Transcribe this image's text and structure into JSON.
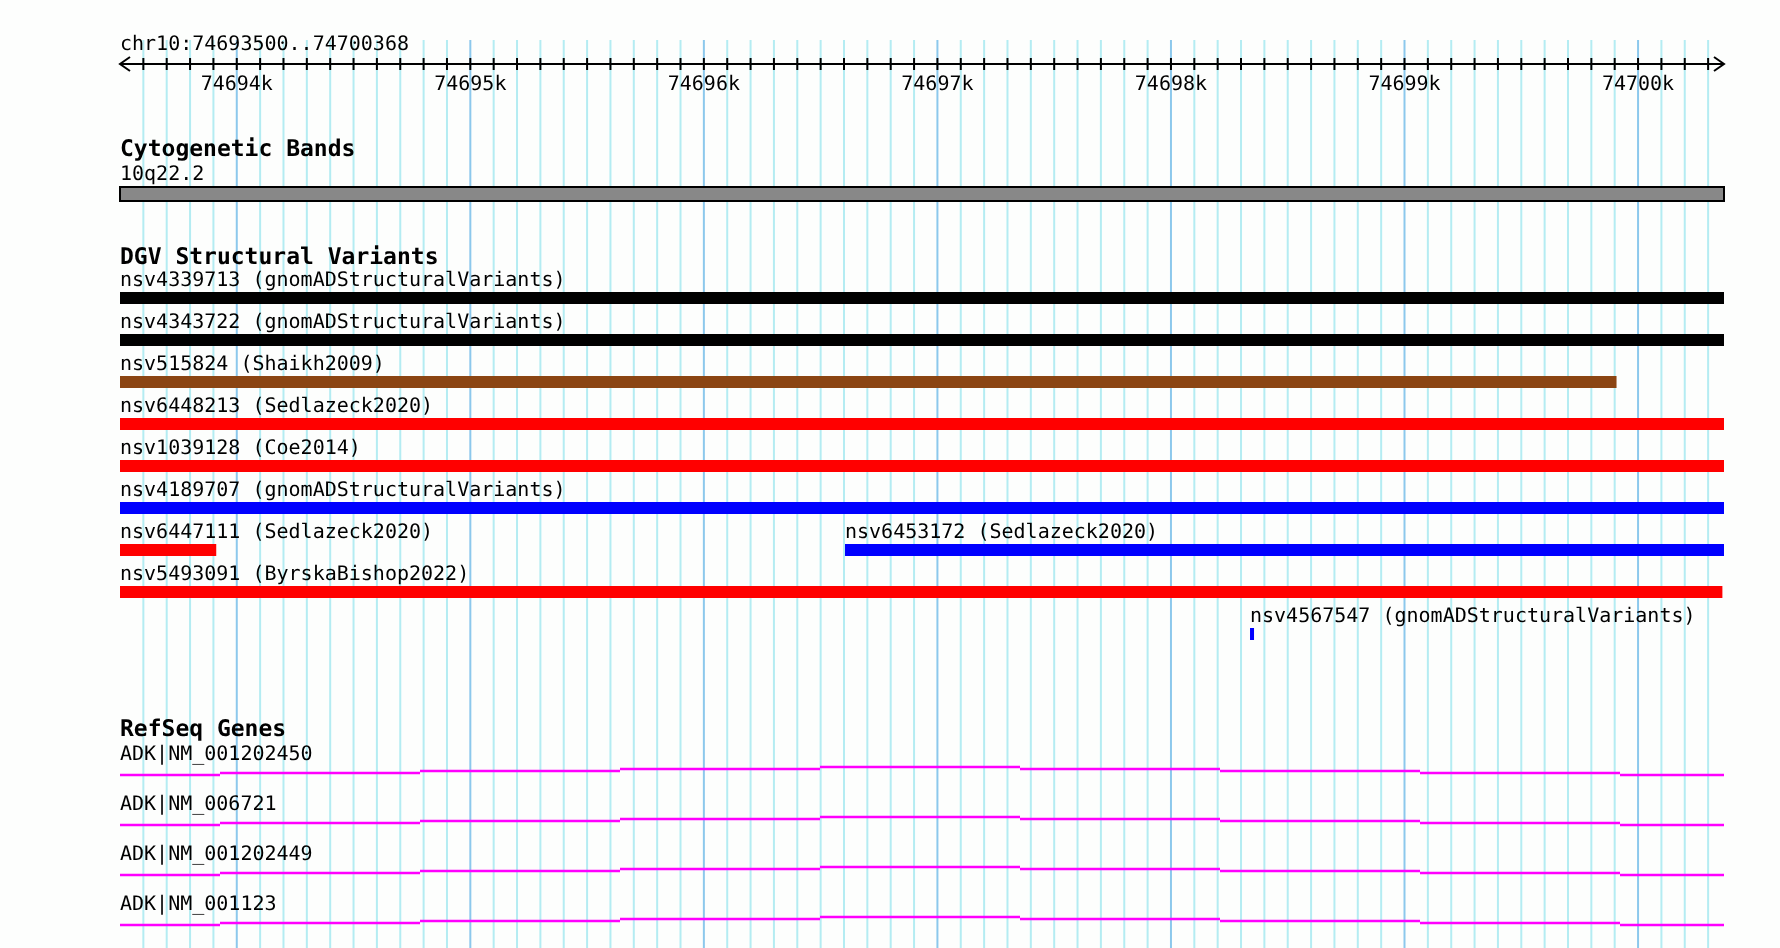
{
  "ruler": {
    "location": "chr10:74693500..74700368",
    "ticks": [
      "74694k",
      "74695k",
      "74696k",
      "74697k",
      "74698k",
      "74699k",
      "74700k"
    ]
  },
  "tracks": [
    {
      "title": "Cytogenetic Bands",
      "kind": "bands",
      "features": [
        {
          "label": "10q22.2"
        }
      ]
    },
    {
      "title": "DGV Structural Variants",
      "kind": "variants",
      "lanes": [
        [
          {
            "label": "nsv4339713 (gnomADStructuralVariants)",
            "color": "#000000"
          }
        ],
        [
          {
            "label": "nsv4343722 (gnomADStructuralVariants)",
            "color": "#000000"
          }
        ],
        [
          {
            "label": "nsv515824 (Shaikh2009)",
            "color": "#8b4513"
          }
        ],
        [
          {
            "label": "nsv6448213 (Sedlazeck2020)",
            "color": "#ff0000"
          }
        ],
        [
          {
            "label": "nsv1039128 (Coe2014)",
            "color": "#ff0000"
          }
        ],
        [
          {
            "label": "nsv4189707 (gnomADStructuralVariants)",
            "color": "#0000ff"
          }
        ],
        [
          {
            "label": "nsv6447111 (Sedlazeck2020)",
            "color": "#ff0000"
          },
          {
            "label": "nsv6453172 (Sedlazeck2020)",
            "color": "#0000ff"
          }
        ],
        [
          {
            "label": "nsv5493091 (ByrskaBishop2022)",
            "color": "#ff0000"
          }
        ],
        [
          {
            "label": "nsv4567547 (gnomADStructuralVariants)",
            "color": "#0000ff"
          }
        ]
      ]
    },
    {
      "title": "RefSeq Genes",
      "kind": "genes",
      "features": [
        {
          "label": "ADK|NM_001202450"
        },
        {
          "label": "ADK|NM_006721"
        },
        {
          "label": "ADK|NM_001202449"
        },
        {
          "label": "ADK|NM_001123"
        }
      ]
    }
  ]
}
